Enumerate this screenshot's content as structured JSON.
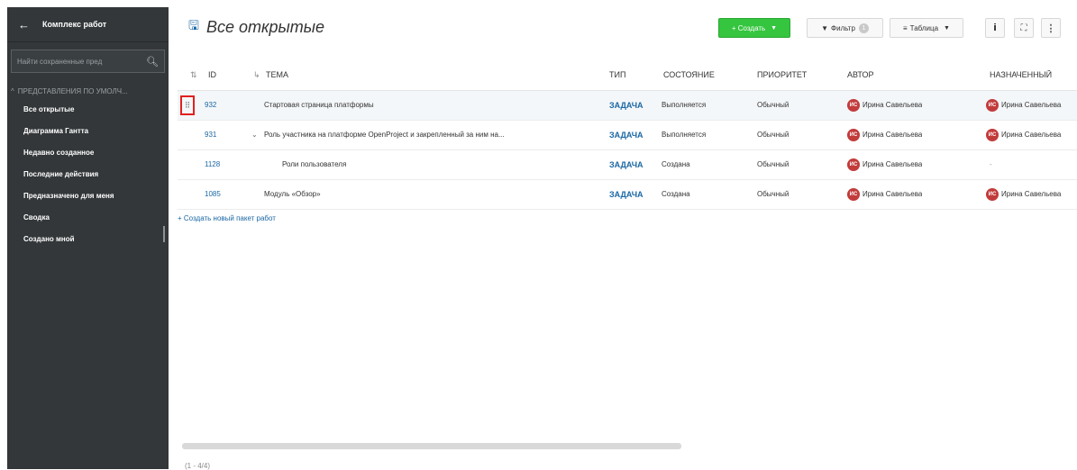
{
  "sidebar": {
    "back_icon": "←",
    "title": "Комплекс работ",
    "search_placeholder": "Найти сохраненные пред",
    "section_title": "ПРЕДСТАВЛЕНИЯ ПО УМОЛЧ...",
    "items": [
      {
        "label": "Все открытые"
      },
      {
        "label": "Диаграмма Гантта"
      },
      {
        "label": "Недавно созданное"
      },
      {
        "label": "Последние действия"
      },
      {
        "label": "Предназначено для меня"
      },
      {
        "label": "Сводка"
      },
      {
        "label": "Создано мной"
      }
    ]
  },
  "header": {
    "title": "Все открытые",
    "create_label": "+ Создать",
    "filter_label": "Фильтр",
    "filter_count": "1",
    "view_label": "Таблица"
  },
  "table": {
    "columns": {
      "id": "ID",
      "subject": "ТЕМА",
      "type": "ТИП",
      "status": "СОСТОЯНИЕ",
      "priority": "ПРИОРИТЕТ",
      "author": "АВТОР",
      "assignee": "НАЗНАЧЕННЫЙ"
    },
    "rows": [
      {
        "id": "932",
        "subject": "Стартовая страница платформы",
        "type": "ЗАДАЧА",
        "status": "Выполняется",
        "priority": "Обычный",
        "author": "Ирина Савельева",
        "author_initials": "ИС",
        "assignee": "Ирина Савельева",
        "assignee_initials": "ИС"
      },
      {
        "id": "931",
        "subject": "Роль участника на платформе OpenProject и закрепленный за ним на...",
        "type": "ЗАДАЧА",
        "status": "Выполняется",
        "priority": "Обычный",
        "author": "Ирина Савельева",
        "author_initials": "ИС",
        "assignee": "Ирина Савельева",
        "assignee_initials": "ИС"
      },
      {
        "id": "1128",
        "subject": "Роли пользователя",
        "type": "ЗАДАЧА",
        "status": "Создана",
        "priority": "Обычный",
        "author": "Ирина Савельева",
        "author_initials": "ИС",
        "assignee": "-",
        "assignee_initials": ""
      },
      {
        "id": "1085",
        "subject": "Модуль «Обзор»",
        "type": "ЗАДАЧА",
        "status": "Создана",
        "priority": "Обычный",
        "author": "Ирина Савельева",
        "author_initials": "ИС",
        "assignee": "Ирина Савельева",
        "assignee_initials": "ИС"
      }
    ],
    "create_new_label": "+ Создать новый пакет работ",
    "pager": "(1 - 4/4)"
  },
  "colors": {
    "sidebar_bg": "#333739",
    "accent": "#1a67a3",
    "create_green": "#35c53f",
    "avatar_red": "#c23b3b",
    "highlight_border": "#e02020"
  }
}
